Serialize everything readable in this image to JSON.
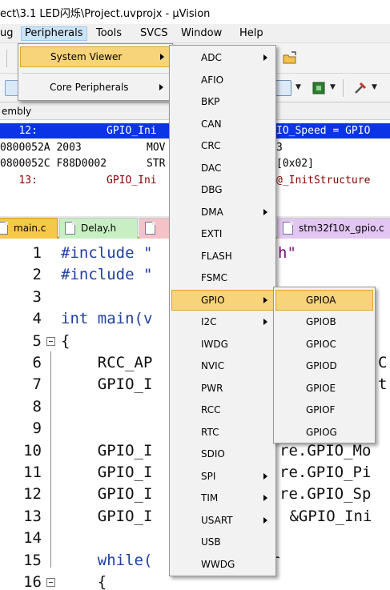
{
  "window": {
    "title": "ect\\3.1  LED闪烁\\Project.uvprojx - µVision"
  },
  "menubar": {
    "items": [
      "ug",
      "Peripherals",
      "Tools",
      "SVCS",
      "Window",
      "Help"
    ]
  },
  "menus": {
    "peripherals": {
      "items": [
        {
          "label": "System Viewer",
          "has_submenu": true
        },
        {
          "label": "Core Peripherals",
          "has_submenu": true
        }
      ]
    },
    "system_viewer": {
      "items": [
        {
          "label": "ADC",
          "has_submenu": true
        },
        {
          "label": "AFIO",
          "has_submenu": false
        },
        {
          "label": "BKP",
          "has_submenu": false
        },
        {
          "label": "CAN",
          "has_submenu": false
        },
        {
          "label": "CRC",
          "has_submenu": false
        },
        {
          "label": "DAC",
          "has_submenu": false
        },
        {
          "label": "DBG",
          "has_submenu": false
        },
        {
          "label": "DMA",
          "has_submenu": true
        },
        {
          "label": "EXTI",
          "has_submenu": false
        },
        {
          "label": "FLASH",
          "has_submenu": false
        },
        {
          "label": "FSMC",
          "has_submenu": false
        },
        {
          "label": "GPIO",
          "has_submenu": true
        },
        {
          "label": "I2C",
          "has_submenu": true
        },
        {
          "label": "IWDG",
          "has_submenu": false
        },
        {
          "label": "NVIC",
          "has_submenu": false
        },
        {
          "label": "PWR",
          "has_submenu": false
        },
        {
          "label": "RCC",
          "has_submenu": false
        },
        {
          "label": "RTC",
          "has_submenu": false
        },
        {
          "label": "SDIO",
          "has_submenu": false
        },
        {
          "label": "SPI",
          "has_submenu": true
        },
        {
          "label": "TIM",
          "has_submenu": true
        },
        {
          "label": "USART",
          "has_submenu": true
        },
        {
          "label": "USB",
          "has_submenu": false
        },
        {
          "label": "WWDG",
          "has_submenu": false
        }
      ]
    },
    "gpio": {
      "items": [
        "GPIOA",
        "GPIOB",
        "GPIOC",
        "GPIOD",
        "GPIOE",
        "GPIOF",
        "GPIOG"
      ]
    }
  },
  "disassembly": {
    "title": "embly",
    "lines": [
      {
        "a": "   12:",
        "b": "GPIO_Ini",
        "c": "IO_Speed = GPIO"
      },
      {
        "a": "0800052A 2003",
        "b": "MOV",
        "c": "3"
      },
      {
        "a": "0800052C F88D0002",
        "b": "STR",
        "c": "[0x02]"
      },
      {
        "a": "   13:",
        "b": "GPIO_Ini",
        "c": "@_InitStructure"
      }
    ]
  },
  "tabs": [
    {
      "label": "main.c",
      "active": true
    },
    {
      "label": "Delay.h",
      "active": false
    },
    {
      "label": "",
      "active": false
    },
    {
      "label": "stm32f10x_gpio.c",
      "active": false
    }
  ],
  "editor": {
    "lines": [
      {
        "n": "1",
        "code": "#include \"",
        "tail": "h\""
      },
      {
        "n": "2",
        "code": "#include \"",
        "tail": ""
      },
      {
        "n": "3",
        "code": "",
        "tail": ""
      },
      {
        "n": "4",
        "code": "int main(v",
        "tail": ""
      },
      {
        "n": "5",
        "code": "{",
        "tail": ""
      },
      {
        "n": "6",
        "code": "    RCC_AP",
        "tail": "C"
      },
      {
        "n": "7",
        "code": "    GPIO_I",
        "tail": "t"
      },
      {
        "n": "8",
        "code": "",
        "tail": ""
      },
      {
        "n": "9",
        "code": "",
        "tail": ""
      },
      {
        "n": "10",
        "code": "    GPIO_I",
        "tail": "re.GPIO_Mo"
      },
      {
        "n": "11",
        "code": "    GPIO_I",
        "tail": "re.GPIO_Pi"
      },
      {
        "n": "12",
        "code": "    GPIO_I",
        "tail": "re.GPIO_Sp"
      },
      {
        "n": "13",
        "code": "    GPIO_I",
        "tail": " &GPIO_Ini"
      },
      {
        "n": "14",
        "code": "",
        "tail": ""
      },
      {
        "n": "15",
        "code": "    while(",
        "tail": "r"
      },
      {
        "n": "16",
        "code": "    {",
        "tail": ""
      }
    ]
  },
  "colors": {
    "menu_highlight": "#f7d37a",
    "disassembly_highlight": "#0a34e6",
    "active_tab": "#f6c84a",
    "keyword": "#1e3fa3",
    "string": "#7a0f7a"
  }
}
